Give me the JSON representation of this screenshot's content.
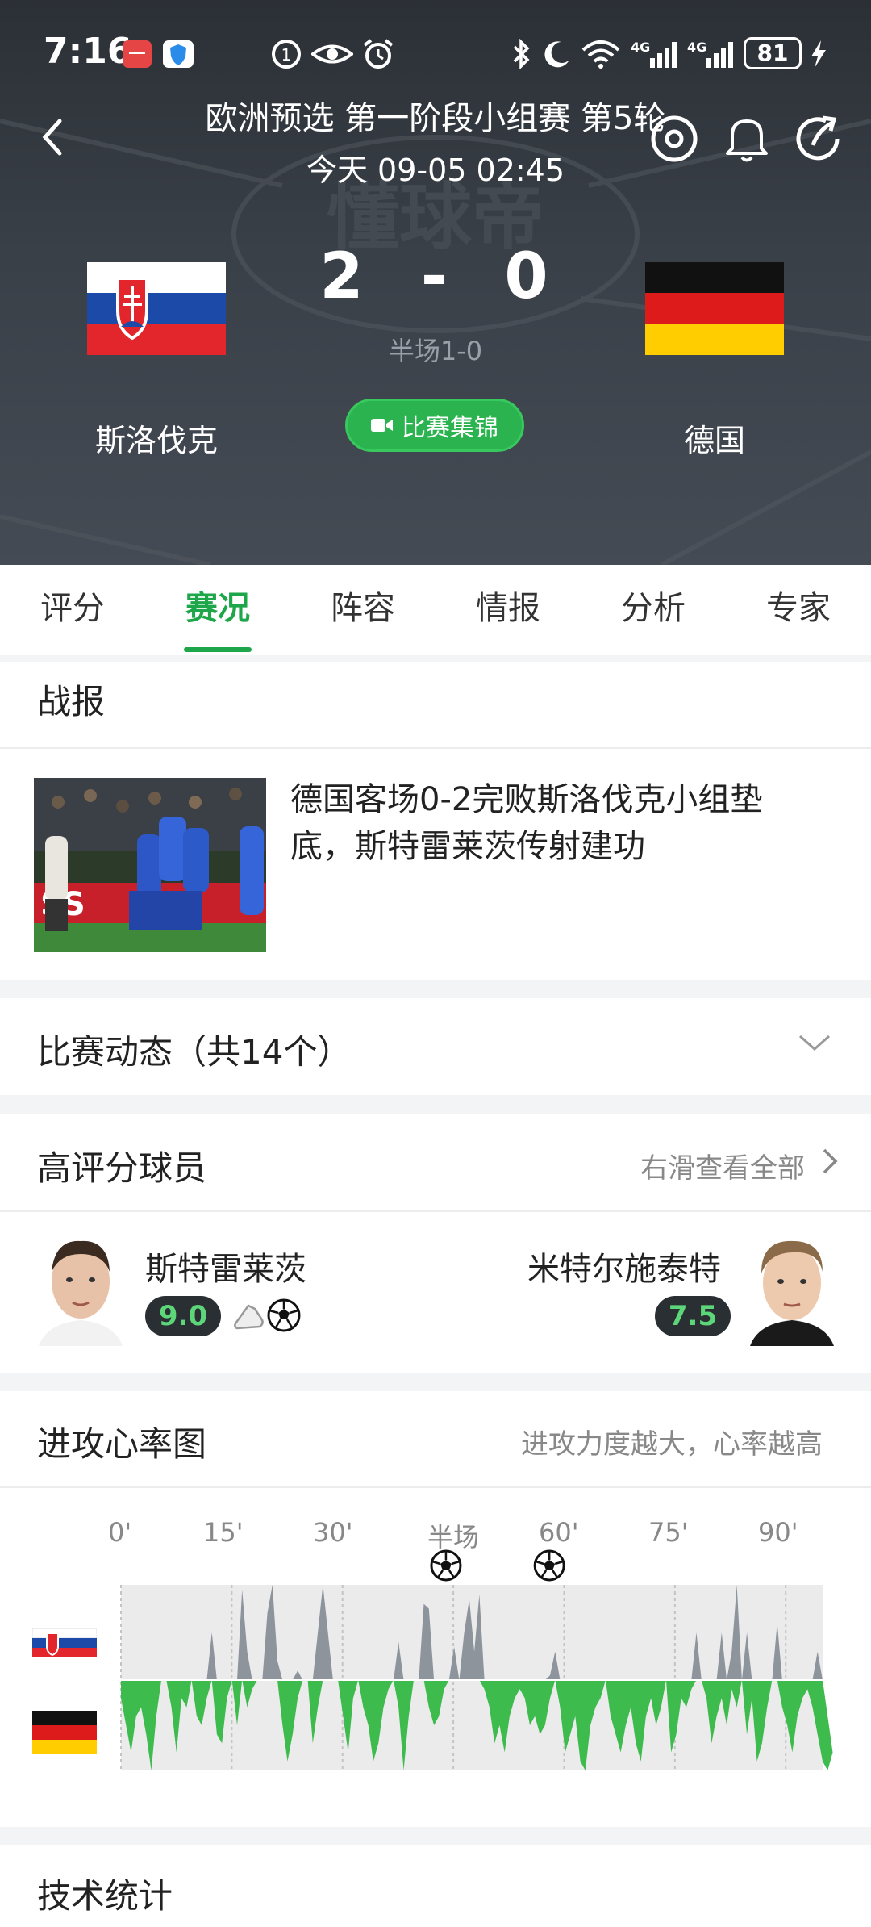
{
  "status_bar": {
    "time": "7:16",
    "battery": "81"
  },
  "header": {
    "league": "欧洲预选 第一阶段小组赛 第5轮",
    "kickoff": "今天 09-05 02:45",
    "watermark": "懂球帝",
    "home": {
      "name": "斯洛伐克",
      "score": "2"
    },
    "away": {
      "name": "德国",
      "score": "0"
    },
    "score_separator": "-",
    "halftime": "半场1-0",
    "highlights_label": "比赛集锦"
  },
  "tabs": [
    "评分",
    "赛况",
    "阵容",
    "情报",
    "分析",
    "专家"
  ],
  "report": {
    "title": "战报",
    "headline": "德国客场0-2完败斯洛伐克小组垫底，斯特雷莱茨传射建功"
  },
  "events": {
    "label": "比赛动态（共14个）"
  },
  "top_players": {
    "title": "高评分球员",
    "see_all": "右滑查看全部",
    "home_player": {
      "name": "斯特雷莱茨",
      "rating": "9.0"
    },
    "away_player": {
      "name": "米特尔施泰特",
      "rating": "7.5"
    }
  },
  "momentum": {
    "title": "进攻心率图",
    "hint": "进攻力度越大，心率越高",
    "axis_labels": [
      "0'",
      "15'",
      "30'",
      "半场",
      "60'",
      "75'",
      "90'"
    ]
  },
  "tech_stats": {
    "title": "技术统计"
  },
  "colors": {
    "accent": "#1ea64a",
    "home_area": "#8e949c",
    "away_area": "#3dbb4c"
  },
  "chart_data": {
    "type": "area",
    "title": "进攻心率图",
    "x_ticks": [
      "0'",
      "15'",
      "30'",
      "半场",
      "60'",
      "75'",
      "90'"
    ],
    "goals_minutes": [
      44,
      58
    ],
    "series": [
      {
        "name": "斯洛伐克",
        "values": [
          0,
          0,
          0,
          0,
          0,
          0,
          0,
          0,
          0,
          0,
          0,
          0,
          0,
          0,
          0,
          0,
          0,
          0,
          0.5,
          0,
          0,
          0,
          0,
          0,
          0.95,
          0.3,
          0,
          0,
          0,
          0.7,
          1,
          0.2,
          0,
          0,
          0,
          0.1,
          0,
          0,
          0,
          0.5,
          1,
          0.5,
          0,
          0,
          0,
          0,
          0,
          0,
          0,
          0,
          0,
          0,
          0,
          0,
          0,
          0.4,
          0,
          0,
          0,
          0,
          0.8,
          0.75,
          0,
          0,
          0,
          0,
          0.35,
          0,
          0.5,
          0.85,
          0.3,
          0.9,
          0,
          0,
          0,
          0,
          0,
          0,
          0,
          0,
          0,
          0,
          0,
          0,
          0,
          0.05,
          0.3,
          0,
          0,
          0,
          0,
          0,
          0,
          0,
          0,
          0,
          0,
          0,
          0,
          0,
          0,
          0,
          0,
          0,
          0,
          0,
          0,
          0,
          0,
          0,
          0,
          0,
          0,
          0,
          0.5,
          0,
          0,
          0,
          0,
          0.5,
          0,
          0.3,
          1,
          0,
          0.5,
          0,
          0,
          0,
          0,
          0,
          0.6,
          0,
          0,
          0,
          0,
          0,
          0,
          0,
          0.3,
          0
        ]
      },
      {
        "name": "德国",
        "values": [
          0.2,
          0.5,
          0.8,
          0.4,
          0.3,
          0.6,
          1,
          0.4,
          0,
          0,
          0.3,
          0.8,
          0.2,
          0.3,
          0,
          0.4,
          0.5,
          0.2,
          0,
          0.6,
          0.7,
          0.2,
          0,
          0.5,
          0,
          0.3,
          0.1,
          0,
          0,
          0,
          0,
          0,
          0.5,
          0.9,
          0.6,
          0.2,
          0,
          0,
          0.7,
          0.3,
          0,
          0,
          0,
          0,
          0.4,
          0.8,
          0.2,
          0,
          0.3,
          0.5,
          0.9,
          0.7,
          0.3,
          0.1,
          0,
          0.3,
          1,
          0.4,
          0,
          0,
          0,
          0.3,
          0.5,
          0.4,
          0.1,
          0,
          0,
          0,
          0,
          0,
          0,
          0,
          0.1,
          0.3,
          0.7,
          0.5,
          0.8,
          0.4,
          0.2,
          0.1,
          0.2,
          0.5,
          0.4,
          0.6,
          0.5,
          0.2,
          0,
          0.3,
          0.8,
          0.6,
          0.4,
          0.9,
          1,
          0.5,
          0.3,
          0.2,
          0,
          0.4,
          0.6,
          0.8,
          0.5,
          0.3,
          0.7,
          0.9,
          0.4,
          0.2,
          0.5,
          0.3,
          0,
          0.8,
          0.6,
          0.2,
          0.3,
          0.1,
          0,
          0,
          0.2,
          0.7,
          0.4,
          0.2,
          0.5,
          0.1,
          0.3,
          0,
          0.6,
          0.2,
          0.9,
          0.7,
          0.3,
          0,
          0,
          0.3,
          0.5,
          0.8,
          0.4,
          0.2,
          0.1,
          0.3,
          0.6,
          0.9,
          1,
          0.8
        ]
      }
    ]
  }
}
